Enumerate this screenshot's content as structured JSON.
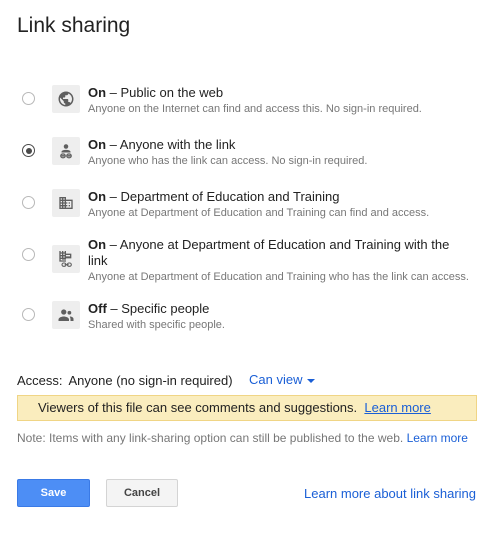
{
  "dialog": {
    "title": "Link sharing"
  },
  "options": [
    {
      "state": "On",
      "title": " – Public on the web",
      "description": "Anyone on the Internet can find and access this. No sign-in required.",
      "icon": "globe-icon",
      "selected": false
    },
    {
      "state": "On",
      "title": " – Anyone with the link",
      "description": "Anyone who has the link can access. No sign-in required.",
      "icon": "person-link-icon",
      "selected": true
    },
    {
      "state": "On",
      "title": " – Department of Education and Training",
      "description": "Anyone at Department of Education and Training can find and access.",
      "icon": "building-icon",
      "selected": false
    },
    {
      "state": "On",
      "title": " – Anyone at Department of Education and Training with the link",
      "description": "Anyone at Department of Education and Training who has the link can access.",
      "icon": "building-link-icon",
      "selected": false
    },
    {
      "state": "Off",
      "title": " – Specific people",
      "description": "Shared with specific people.",
      "icon": "people-icon",
      "selected": false
    }
  ],
  "access": {
    "label": "Access:",
    "value": "Anyone (no sign-in required)",
    "permission": "Can view"
  },
  "notice": {
    "text": "Viewers of this file can see comments and suggestions.",
    "link": "Learn more"
  },
  "note": {
    "text": "Note: Items with any link-sharing option can still be published to the web.",
    "link": "Learn more"
  },
  "buttons": {
    "save": "Save",
    "cancel": "Cancel"
  },
  "footer": {
    "link": "Learn more about link sharing"
  },
  "colors": {
    "link": "#1a5fd6",
    "primary_button": "#4d8ef5",
    "notice_bg": "#faedbe"
  }
}
